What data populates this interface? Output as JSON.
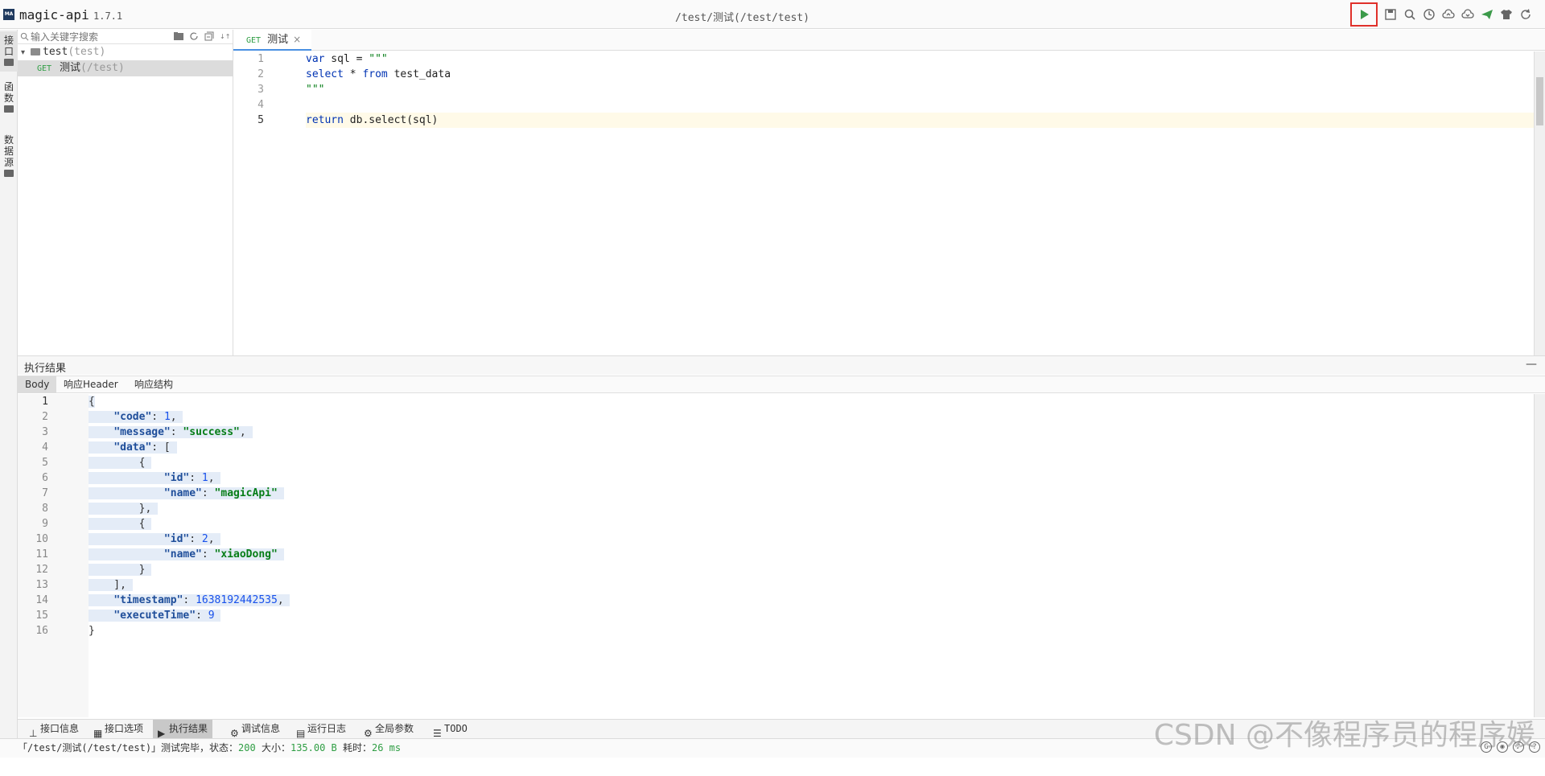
{
  "app": {
    "name": "magic-api",
    "version": "1.7.1",
    "logo_text": "MA",
    "title_path": "/test/测试(/test/test)"
  },
  "toolbar": {
    "icons": [
      "run-icon",
      "save-icon",
      "search-icon",
      "history-icon",
      "upload-icon",
      "download-icon",
      "push-icon",
      "skin-icon",
      "refresh-icon"
    ]
  },
  "activity": {
    "items": [
      {
        "label": "接口"
      },
      {
        "label": "函数"
      },
      {
        "label": "数据源"
      }
    ]
  },
  "sidebar": {
    "search_placeholder": "输入关键字搜索",
    "group": {
      "name": "test",
      "path": "(test)"
    },
    "api": {
      "method": "GET",
      "name": "测试",
      "path": "(/test)"
    }
  },
  "editor": {
    "tab": {
      "method": "GET",
      "name": "测试",
      "close": "×"
    },
    "line_numbers": [
      "1",
      "2",
      "3",
      "4",
      "5"
    ],
    "lines": [
      {
        "kw": "var",
        "rest": " sql = ",
        "str": "\"\"\""
      },
      {
        "kw": "select",
        "rest": " * ",
        "kw2": "from",
        "rest2": " test_data"
      },
      {
        "str": "\"\"\""
      },
      {},
      {
        "kw": "return",
        "rest": " db.select(sql)"
      }
    ]
  },
  "result": {
    "title": "执行结果",
    "minimize": "—",
    "tabs": [
      "Body",
      "响应Header",
      "响应结构"
    ],
    "line_numbers": [
      "1",
      "2",
      "3",
      "4",
      "5",
      "6",
      "7",
      "8",
      "9",
      "10",
      "11",
      "12",
      "13",
      "14",
      "15",
      "16"
    ],
    "json": {
      "code": "1",
      "message": "\"success\"",
      "items": [
        {
          "id": "1",
          "name": "\"magicApi\""
        },
        {
          "id": "2",
          "name": "\"xiaoDong\""
        }
      ],
      "timestamp": "1638192442535",
      "executeTime": "9"
    }
  },
  "bottom_tabs": [
    "接口信息",
    "接口选项",
    "执行结果",
    "调试信息",
    "运行日志",
    "全局参数",
    "TODO"
  ],
  "status": {
    "prefix": "「/test/测试(/test/test)」测试完毕，状态：",
    "code": "200",
    "size_label": " 大小：",
    "size": "135.00 B",
    "time_label": " 耗时：",
    "time": "26 ms"
  },
  "watermark": "CSDN @不像程序员的程序媛"
}
